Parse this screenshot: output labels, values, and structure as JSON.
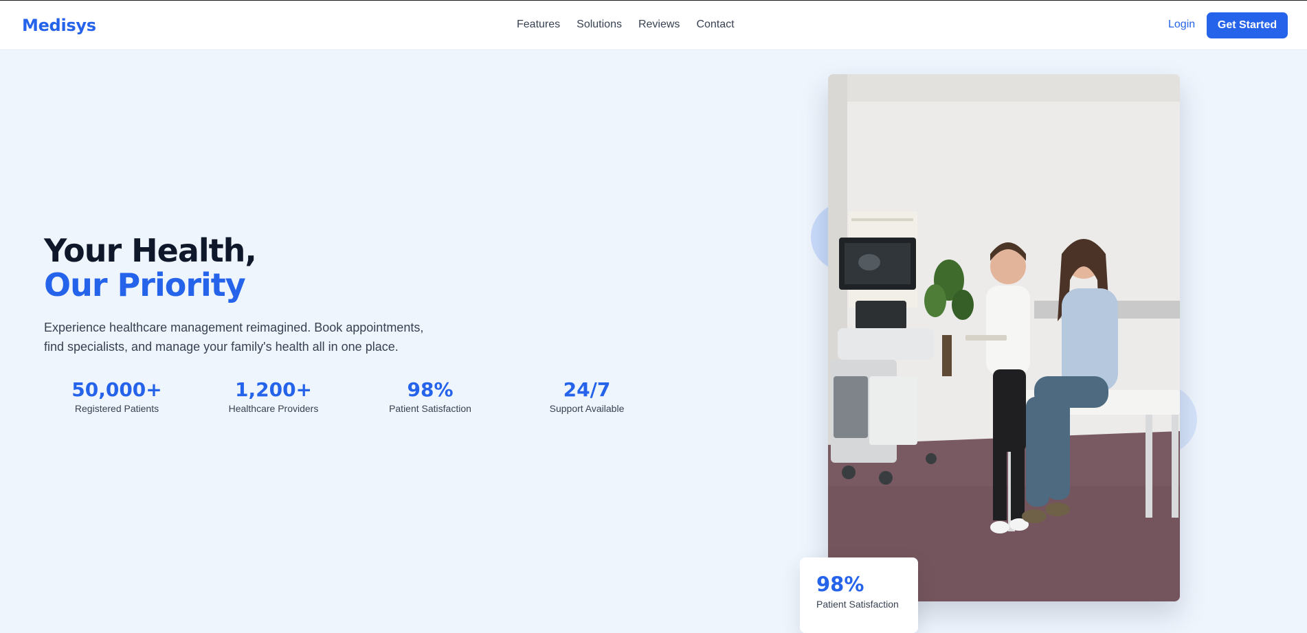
{
  "brand": {
    "name": "Medisys",
    "accent": "#2563eb"
  },
  "nav": {
    "links": [
      "Features",
      "Solutions",
      "Reviews",
      "Contact"
    ],
    "login": "Login",
    "cta": "Get Started"
  },
  "hero": {
    "title_line1": "Your Health,",
    "title_line2": "Our Priority",
    "description": "Experience healthcare management reimagined. Book appointments, find specialists, and manage your family's health all in one place."
  },
  "stats": [
    {
      "value": "50,000+",
      "label": "Registered Patients"
    },
    {
      "value": "1,200+",
      "label": "Healthcare Providers"
    },
    {
      "value": "98%",
      "label": "Patient Satisfaction"
    },
    {
      "value": "24/7",
      "label": "Support Available"
    }
  ],
  "image": {
    "icon": "doctor-consultation-photo"
  },
  "floating_card": {
    "value": "98%",
    "label": "Patient Satisfaction"
  }
}
